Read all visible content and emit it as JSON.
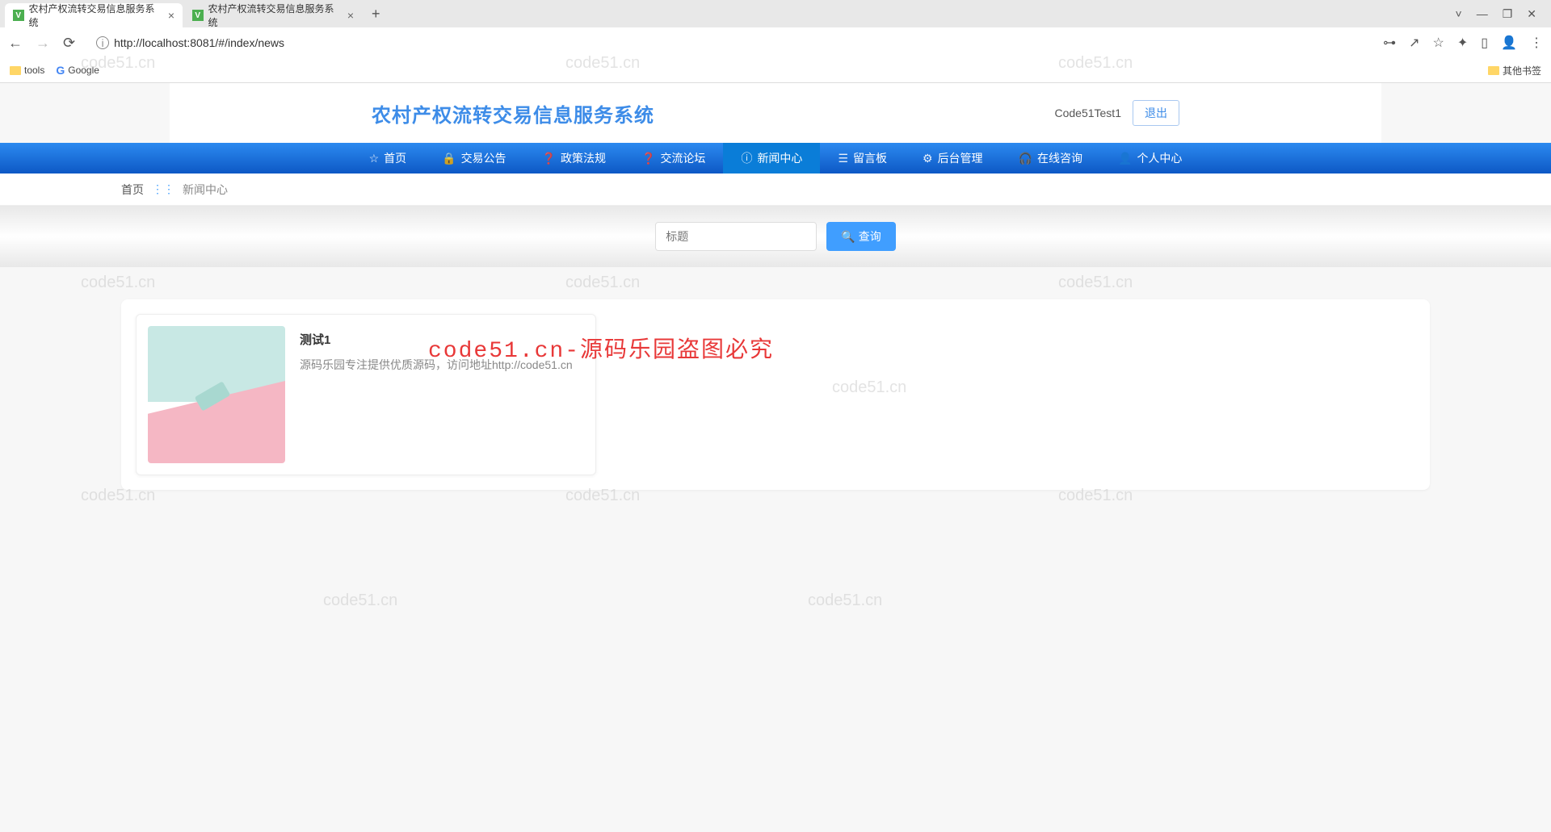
{
  "browser": {
    "tabs": [
      {
        "title": "农村产权流转交易信息服务系统"
      },
      {
        "title": "农村产权流转交易信息服务系统"
      }
    ],
    "url": "http://localhost:8081/#/index/news",
    "bookmarks": {
      "tools": "tools",
      "google": "Google",
      "other": "其他书签"
    }
  },
  "header": {
    "logo": "农村产权流转交易信息服务系统",
    "username": "Code51Test1",
    "logout": "退出"
  },
  "nav": {
    "items": [
      {
        "icon": "☆",
        "label": "首页"
      },
      {
        "icon": "🔒",
        "label": "交易公告"
      },
      {
        "icon": "❓",
        "label": "政策法规"
      },
      {
        "icon": "❓",
        "label": "交流论坛"
      },
      {
        "icon": "ⓘ",
        "label": "新闻中心",
        "active": true
      },
      {
        "icon": "☰",
        "label": "留言板"
      },
      {
        "icon": "⚙",
        "label": "后台管理"
      },
      {
        "icon": "🎧",
        "label": "在线咨询"
      },
      {
        "icon": "👤",
        "label": "个人中心"
      }
    ]
  },
  "breadcrumb": {
    "home": "首页",
    "current": "新闻中心"
  },
  "search": {
    "placeholder": "标题",
    "button": "查询"
  },
  "news": [
    {
      "title": "测试1",
      "desc": "源码乐园专注提供优质源码，访问地址http://code51.cn"
    }
  ],
  "watermarks": {
    "text": "code51.cn",
    "red": "code51.cn-源码乐园盗图必究"
  }
}
